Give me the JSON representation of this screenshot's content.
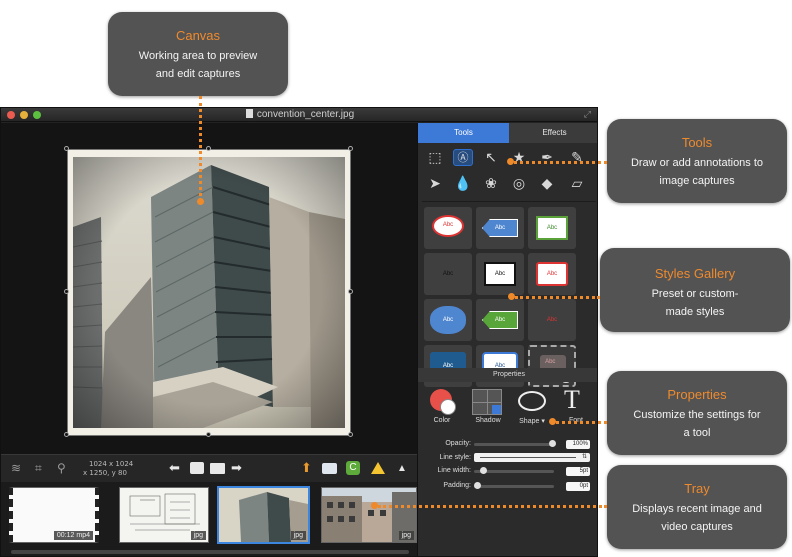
{
  "window": {
    "title": "convention_center.jpg",
    "tabs": [
      {
        "label": "Tools",
        "active": true
      },
      {
        "label": "Effects",
        "active": false
      }
    ],
    "accent_color": "#3d7ad8"
  },
  "tools": {
    "icons": [
      "selection-rect-icon",
      "text-callout-icon",
      "arrow-icon",
      "stamp-icon",
      "pen-icon",
      "pencil-icon",
      "pointer-icon",
      "blur-drop-icon",
      "color-swatch-icon",
      "camera-icon",
      "fill-bucket-icon",
      "eraser-icon"
    ],
    "selected": "text-callout-icon"
  },
  "styles_gallery": {
    "tiles": [
      {
        "text": "Abc"
      },
      {
        "text": "Abc"
      },
      {
        "text": "Abc"
      },
      {
        "text": "Abc"
      },
      {
        "text": "Abc"
      },
      {
        "text": "Abc"
      },
      {
        "text": "Abc"
      },
      {
        "text": "Abc"
      },
      {
        "text": "Abc"
      },
      {
        "text": "Abc"
      },
      {
        "text": "Abc"
      },
      {
        "text": "Abc"
      }
    ]
  },
  "properties": {
    "header": "Properties",
    "buttons": {
      "color": "Color",
      "shadow": "Shadow",
      "shape": "Shape ▾",
      "font": "Font"
    },
    "opacity": {
      "label": "Opacity:",
      "value": "100%",
      "level": 1.0
    },
    "line_style": {
      "label": "Line style:"
    },
    "line_width": {
      "label": "Line width:",
      "value": "5pt",
      "level": 0.08
    },
    "padding": {
      "label": "Padding:",
      "value": "0pt",
      "level": 0.0
    }
  },
  "bottombar": {
    "dims_line1": "1024 x 1024",
    "dims_line2": "x 1250,  y 80"
  },
  "tray": {
    "items": [
      {
        "badge": "00:12 mp4",
        "selected": false
      },
      {
        "badge": "jpg",
        "selected": false
      },
      {
        "badge": "jpg",
        "selected": true
      },
      {
        "badge": "jpg",
        "selected": false
      }
    ]
  },
  "callouts": {
    "canvas": {
      "title": "Canvas",
      "desc": "Working area to preview and edit captures"
    },
    "tools": {
      "title": "Tools",
      "desc": "Draw or add annotations to image captures"
    },
    "styles": {
      "title": "Styles Gallery",
      "desc": "Preset or custom-made styles"
    },
    "properties": {
      "title": "Properties",
      "desc": "Customize the settings for a tool"
    },
    "tray": {
      "title": "Tray",
      "desc": "Displays recent image and video captures"
    }
  }
}
